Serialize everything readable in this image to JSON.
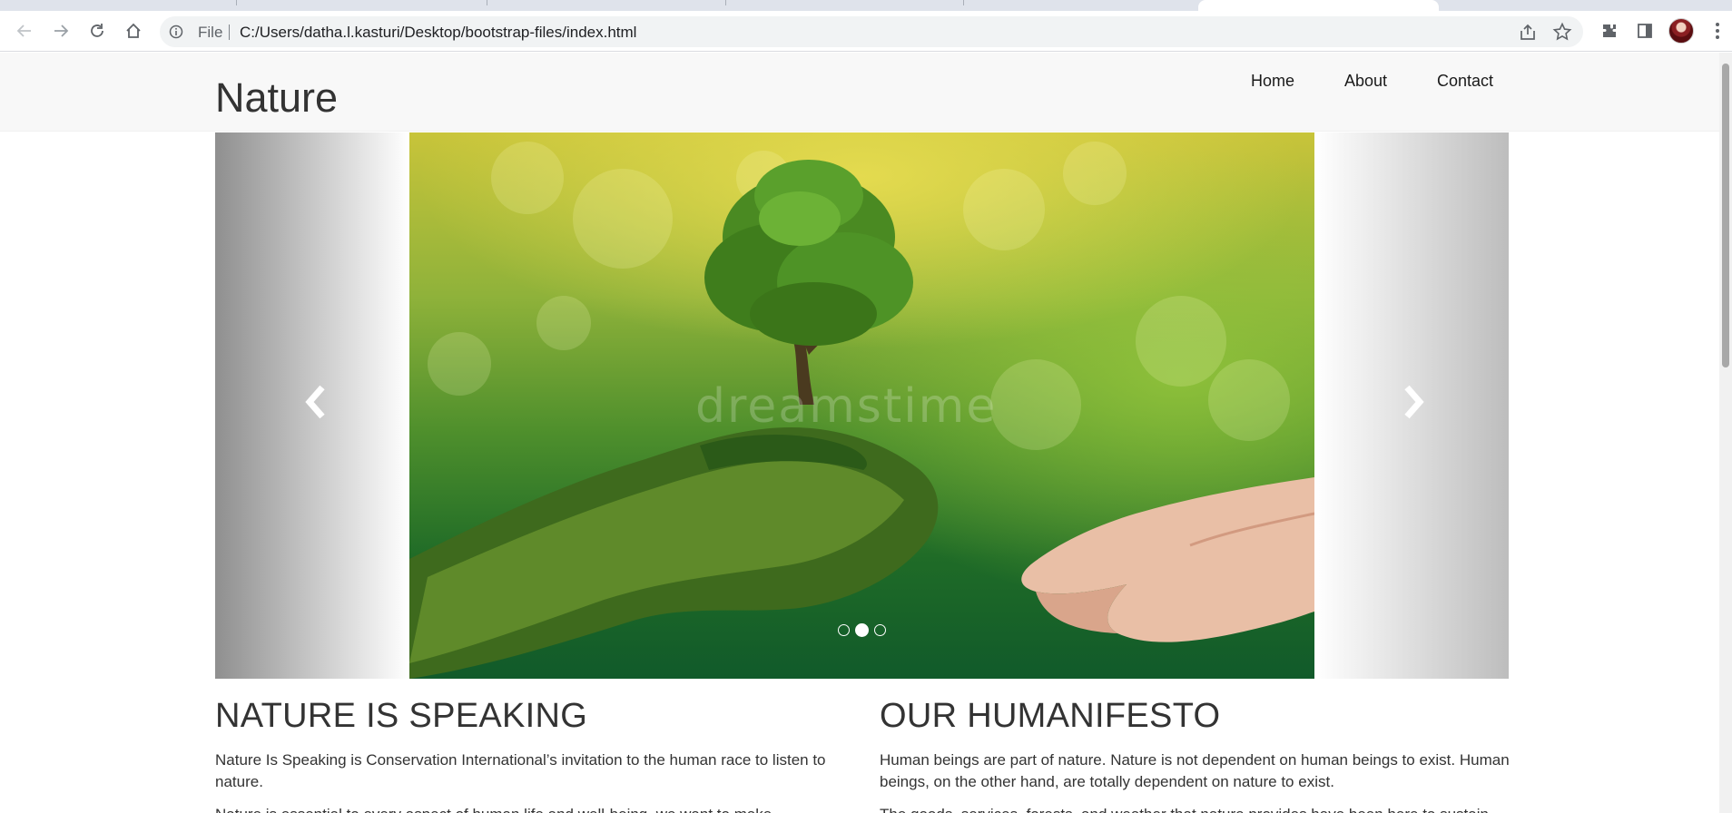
{
  "browser": {
    "omnibox": {
      "scheme_label": "File",
      "url": "C:/Users/datha.l.kasturi/Desktop/bootstrap-files/index.html"
    }
  },
  "site": {
    "brand": "Nature",
    "nav": [
      "Home",
      "About",
      "Contact"
    ]
  },
  "carousel": {
    "slide_count": 3,
    "active_index": 1,
    "watermark": "dreamstime",
    "prev_icon": "chevron-left-icon",
    "next_icon": "chevron-right-icon"
  },
  "sections": [
    {
      "heading": "NATURE IS SPEAKING",
      "paragraph": "Nature Is Speaking is Conservation International’s invitation to the human race to listen to nature.",
      "paragraph_2": "Nature is essential to every aspect of human life and well-being, we want to make"
    },
    {
      "heading": "OUR HUMANIFESTO",
      "paragraph": "Human beings are part of nature. Nature is not dependent on human beings to exist. Human beings, on the other hand, are totally dependent on nature to exist.",
      "paragraph_2": "The goods, services, forests, and weather that nature provides have been here to sustain and"
    }
  ],
  "colors": {
    "navbar_bg": "#f8f8f8",
    "text": "#333333"
  }
}
